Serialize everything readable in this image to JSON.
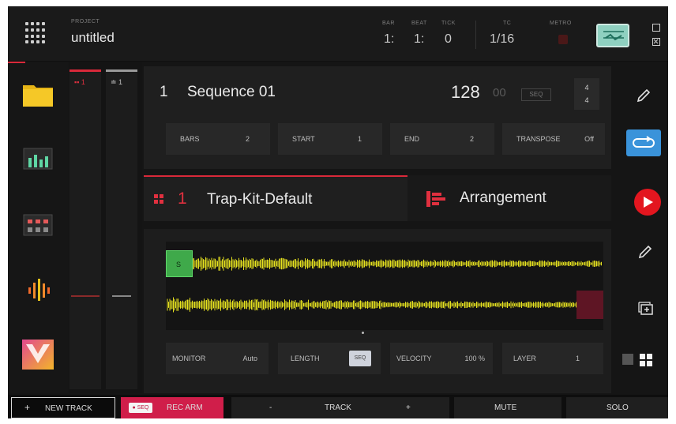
{
  "header": {
    "project_label": "PROJECT",
    "project_name": "untitled",
    "bar_label": "BAR",
    "bar_value": "1:",
    "beat_label": "BEAT",
    "beat_value": "1:",
    "tick_label": "TICK",
    "tick_value": "0",
    "tc_label": "TC",
    "tc_value": "1/16",
    "metro_label": "METRO",
    "icons": [
      "grid-menu-icon",
      "mixer-icon",
      "window-icon",
      "close-window-icon"
    ]
  },
  "sidebar": {
    "icons": [
      "folder-icon",
      "mixer-levels-icon",
      "pads-mixer-icon",
      "sample-edit-icon",
      "app-logo-icon"
    ]
  },
  "strips": {
    "track1_label": "1",
    "track2_label": "1"
  },
  "sequence": {
    "number": "1",
    "name": "Sequence 01",
    "bpm": "128",
    "bpm_decimal": "00",
    "bpm_badge": "SEQ",
    "timesig_top": "4",
    "timesig_bottom": "4",
    "params": [
      {
        "label": "BARS",
        "value": "2"
      },
      {
        "label": "START",
        "value": "1"
      },
      {
        "label": "END",
        "value": "2"
      },
      {
        "label": "TRANSPOSE",
        "value": "Off"
      }
    ]
  },
  "tabs": {
    "track_number": "1",
    "track_name": "Trap-Kit-Default",
    "arrangement_name": "Arrangement"
  },
  "waveform": {
    "start_marker": "S",
    "params": {
      "monitor_label": "MONITOR",
      "monitor_value": "Auto",
      "length_label": "LENGTH",
      "length_value": "SEQ",
      "velocity_label": "VELOCITY",
      "velocity_value": "100 %",
      "layer_label": "LAYER",
      "layer_value": "1"
    }
  },
  "bottom": {
    "new_track": "NEW TRACK",
    "rec_arm_badge": "SEQ",
    "rec_arm": "REC ARM",
    "track_minus": "-",
    "track": "TRACK",
    "track_plus": "+",
    "mute": "MUTE",
    "solo": "SOLO"
  },
  "colors": {
    "accent_red": "#d9293a",
    "loop_blue": "#3a93da",
    "wave_yellow": "#e6e21f",
    "start_green": "#3fa94a",
    "rec_arm": "#d01e4a"
  }
}
